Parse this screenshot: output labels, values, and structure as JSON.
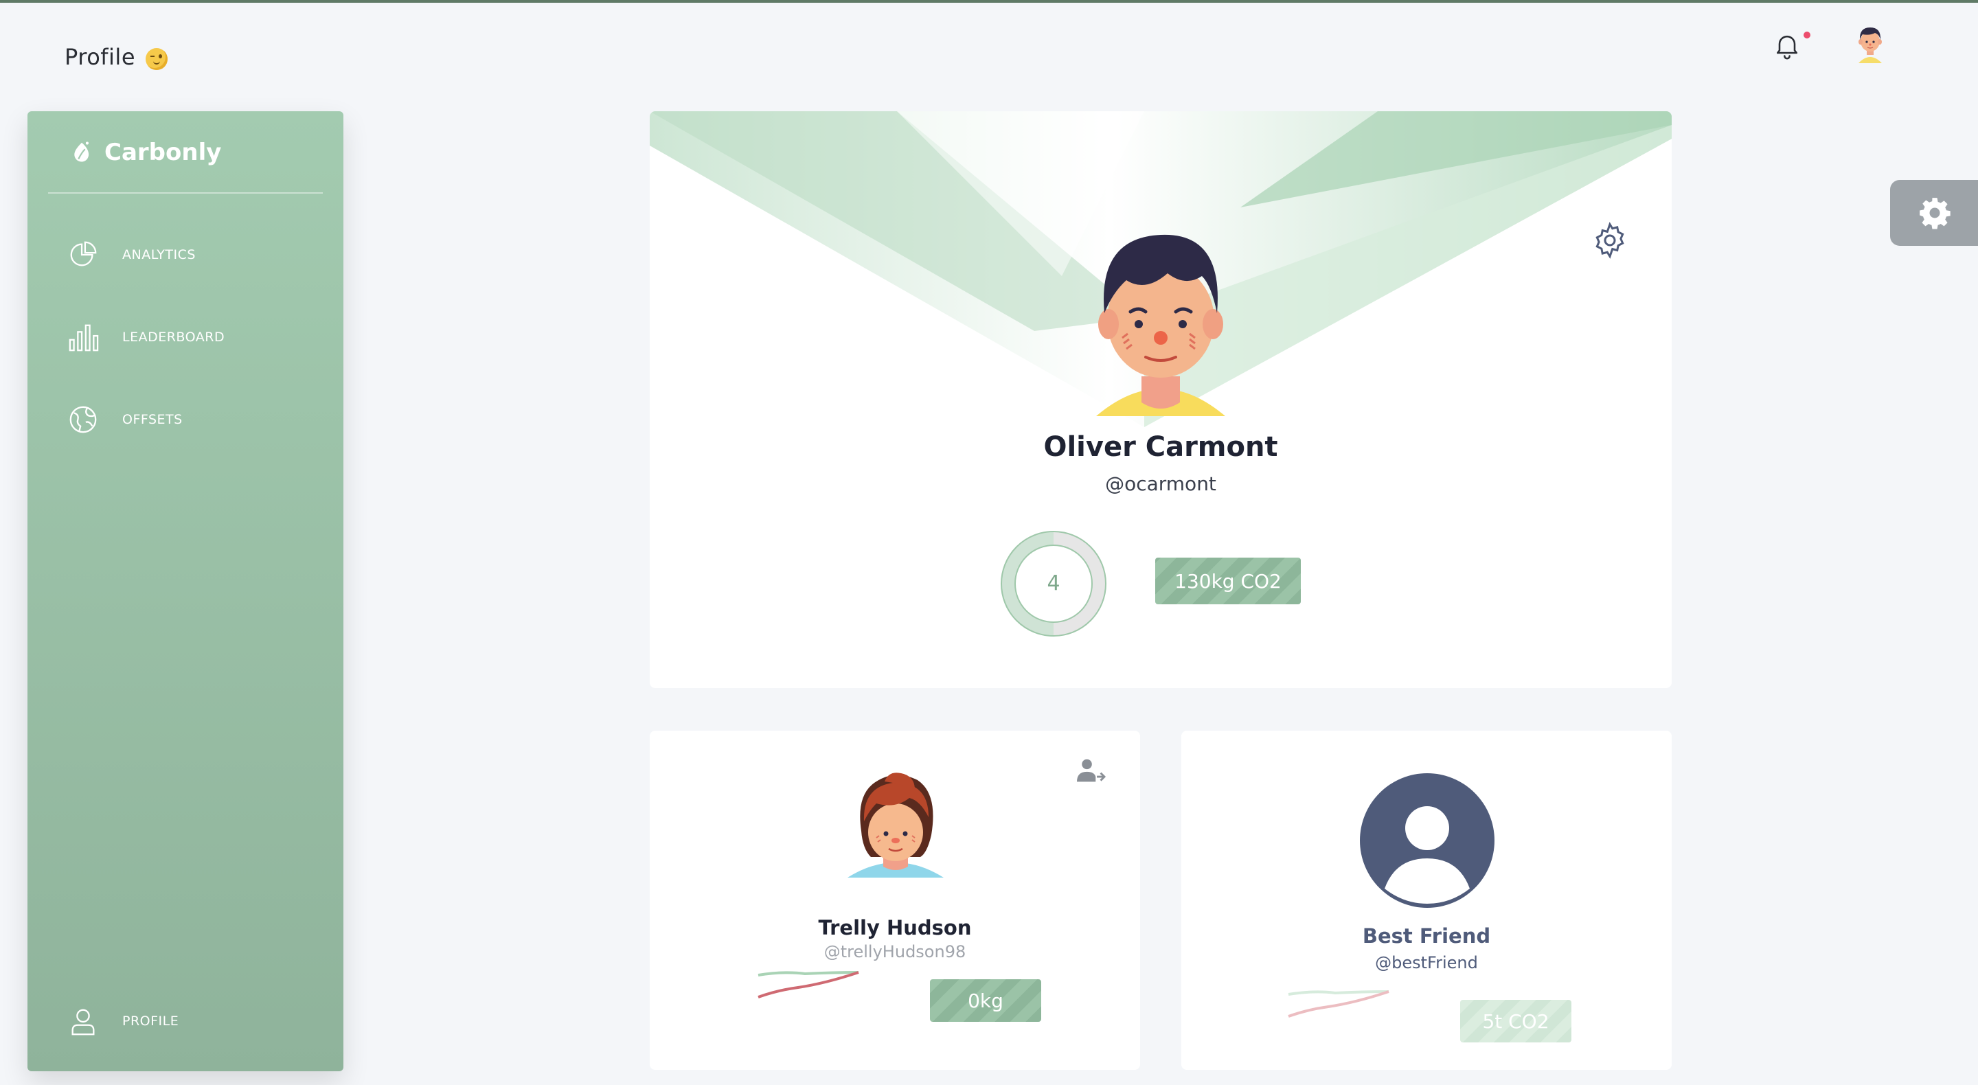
{
  "header": {
    "title": "Profile",
    "emoji_icon": "winking-face-icon"
  },
  "notifications": {
    "has_unread": true,
    "dot_color": "#ec4d6d"
  },
  "sidebar": {
    "brand": "Carbonly",
    "items": [
      {
        "label": "ANALYTICS",
        "icon": "pie-chart-icon"
      },
      {
        "label": "LEADERBOARD",
        "icon": "bar-chart-icon"
      },
      {
        "label": "OFFSETS",
        "icon": "globe-icon"
      }
    ],
    "footer_item": {
      "label": "PROFILE",
      "icon": "user-icon"
    }
  },
  "profile": {
    "name": "Oliver Carmont",
    "handle": "@ocarmont",
    "ring_value": "4",
    "co2": "130kg CO2"
  },
  "friends": [
    {
      "name": "Trelly Hudson",
      "handle": "@trellyHudson98",
      "amount": "0kg"
    },
    {
      "name": "Best Friend",
      "handle": "@bestFriend",
      "amount": "5t CO2"
    }
  ],
  "colors": {
    "accent": "#8fb39b",
    "accent_light": "#a3cbb0",
    "text_dark": "#1f2333",
    "best_friend_name": "#4f5b7a"
  }
}
